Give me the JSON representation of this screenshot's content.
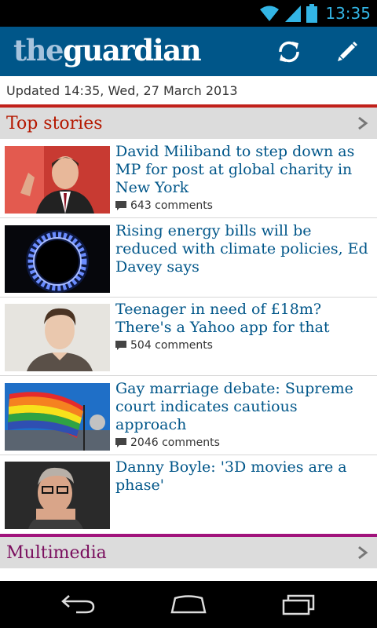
{
  "status_bar": {
    "time": "13:35",
    "icons": [
      "wifi-icon",
      "signal-icon",
      "battery-icon"
    ]
  },
  "app_bar": {
    "logo_prefix": "the",
    "logo_main": "guardian",
    "actions": [
      "refresh-icon",
      "compose-pencil-icon"
    ],
    "colors": {
      "background": "#005689",
      "logo_prefix": "#a6c3dd"
    }
  },
  "updated_text": "Updated 14:35, Wed, 27 March 2013",
  "sections": {
    "top_stories": {
      "title": "Top stories",
      "accent": "#c1201a"
    },
    "multimedia": {
      "title": "Multimedia",
      "accent": "#a1137c"
    }
  },
  "stories": [
    {
      "headline": "David Miliband to step down as MP for post at global charity in New York",
      "comments": "643 comments"
    },
    {
      "headline": "Rising energy bills will be reduced with climate policies, Ed Davey says",
      "comments": ""
    },
    {
      "headline": "Teenager in need of £18m? There's a Yahoo app for that",
      "comments": "504 comments"
    },
    {
      "headline": "Gay marriage debate: Supreme court indicates cautious approach",
      "comments": "2046 comments"
    },
    {
      "headline": "Danny Boyle: '3D movies are a phase'",
      "comments": ""
    }
  ],
  "nav_bar": {
    "buttons": [
      "back-icon",
      "home-icon",
      "recent-apps-icon"
    ]
  }
}
